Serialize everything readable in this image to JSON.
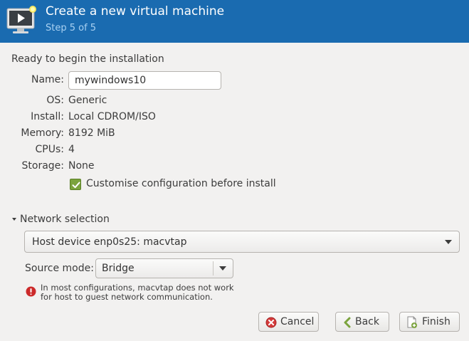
{
  "header": {
    "title": "Create a new virtual machine",
    "subtitle": "Step 5 of 5",
    "logo_icon": "virtual-machine-monitor-icon",
    "colors": {
      "background": "#1a6bb0",
      "subtitle": "#a9d1f2"
    }
  },
  "summary": {
    "heading": "Ready to begin the installation",
    "name_label": "Name:",
    "name_value": "mywindows10",
    "rows": [
      {
        "label": "OS:",
        "value": "Generic"
      },
      {
        "label": "Install:",
        "value": "Local CDROM/ISO"
      },
      {
        "label": "Memory:",
        "value": "8192 MiB"
      },
      {
        "label": "CPUs:",
        "value": "4"
      },
      {
        "label": "Storage:",
        "value": "None"
      }
    ],
    "customise_label": "Customise configuration before install",
    "customise_checked": true
  },
  "network": {
    "expander_label": "Network selection",
    "device_selected": "Host device enp0s25: macvtap",
    "source_mode_label": "Source mode:",
    "source_mode_selected": "Bridge",
    "warning_lines": [
      "In most configurations, macvtap does not work",
      "for host to guest network communication."
    ]
  },
  "buttons": {
    "cancel": "Cancel",
    "back": "Back",
    "finish": "Finish"
  },
  "colors": {
    "checkbox": "#7ba33d",
    "error": "#cc2a2a"
  }
}
